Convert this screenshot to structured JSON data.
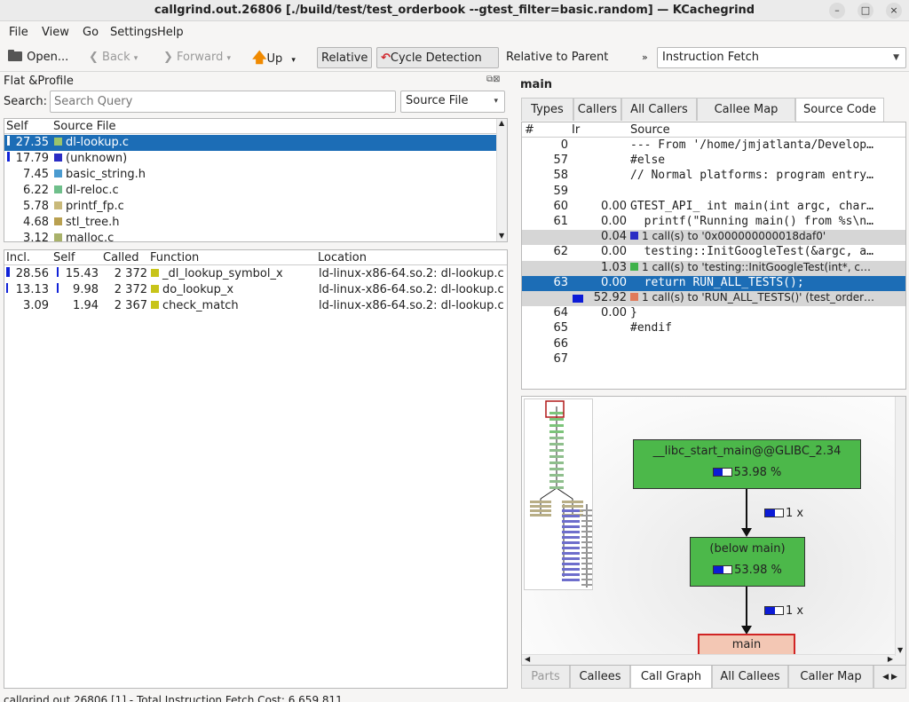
{
  "window": {
    "title": "callgrind.out.26806 [./build/test/test_orderbook --gtest_filter=basic.random] — KCachegrind",
    "btn_min": "–",
    "btn_max": "□",
    "btn_close": "×"
  },
  "menu": [
    "File",
    "View",
    "Go",
    "Settings",
    "Help"
  ],
  "toolbar": {
    "open": "Open...",
    "back": "Back",
    "forward": "Forward",
    "up": "Up",
    "relative": "Relative",
    "cycle": "Cycle Detection",
    "relative_parent": "Relative to Parent",
    "more": "»",
    "event_type": "Instruction Fetch"
  },
  "flat_profile": {
    "title": "Flat &Profile",
    "search_label": "Search:",
    "search_placeholder": "Search Query",
    "group_by": "Source File",
    "headers": [
      "Self",
      "Source File"
    ],
    "rows": [
      {
        "self": "27.35",
        "name": "dl-lookup.c",
        "color": "#9bc46b",
        "selected": true,
        "bar": true
      },
      {
        "self": "17.79",
        "name": "(unknown)",
        "color": "#2a2cc4",
        "selected": false,
        "bar": true
      },
      {
        "self": "7.45",
        "name": "basic_string.h",
        "color": "#4b9bd0",
        "selected": false,
        "bar": false
      },
      {
        "self": "6.22",
        "name": "dl-reloc.c",
        "color": "#6fbf8b",
        "selected": false,
        "bar": false
      },
      {
        "self": "5.78",
        "name": "printf_fp.c",
        "color": "#c9b97a",
        "selected": false,
        "bar": false
      },
      {
        "self": "4.68",
        "name": "stl_tree.h",
        "color": "#b9a050",
        "selected": false,
        "bar": false
      },
      {
        "self": "3.12",
        "name": "malloc.c",
        "color": "#a9b26a",
        "selected": false,
        "bar": false
      }
    ]
  },
  "functions": {
    "headers": [
      "Incl.",
      "Self",
      "Called",
      "Function",
      "Location"
    ],
    "rows": [
      {
        "incl": "28.56",
        "self": "15.43",
        "called": "2 372",
        "name": "_dl_lookup_symbol_x",
        "location": "ld-linux-x86-64.so.2: dl-lookup.c",
        "color": "#c8c41a"
      },
      {
        "incl": "13.13",
        "self": "9.98",
        "called": "2 372",
        "name": "do_lookup_x",
        "location": "ld-linux-x86-64.so.2: dl-lookup.c",
        "color": "#c8c41a"
      },
      {
        "incl": "3.09",
        "self": "1.94",
        "called": "2 367",
        "name": "check_match",
        "location": "ld-linux-x86-64.so.2: dl-lookup.c",
        "color": "#c8c41a"
      }
    ]
  },
  "right": {
    "function_name": "main",
    "tabs": [
      "Types",
      "Callers",
      "All Callers",
      "Callee Map",
      "Source Code"
    ],
    "active_tab": "Source Code",
    "source_headers": [
      "#",
      "Ir",
      "Source"
    ],
    "source_rows": [
      {
        "line": "0",
        "ir": "",
        "src": "--- From '/home/jmjatlanta/Develop…"
      },
      {
        "line": "57",
        "ir": "",
        "src": "#else"
      },
      {
        "line": "58",
        "ir": "",
        "src": "// Normal platforms: program entry…"
      },
      {
        "line": "59",
        "ir": "",
        "src": ""
      },
      {
        "line": "60",
        "ir": "0.00",
        "src": "GTEST_API_ int main(int argc, char…"
      },
      {
        "line": "61",
        "ir": "0.00",
        "src": "  printf(\"Running main() from %s\\n…"
      },
      {
        "line": "",
        "ir": "0.04",
        "call": "1 call(s) to '0x000000000018daf0'",
        "color": "#2a2cc4"
      },
      {
        "line": "62",
        "ir": "0.00",
        "src": "  testing::InitGoogleTest(&argc, a…"
      },
      {
        "line": "",
        "ir": "1.03",
        "call": "1 call(s) to 'testing::InitGoogleTest(int*, c…",
        "color": "#3fb24a"
      },
      {
        "line": "63",
        "ir": "0.00",
        "src": "  return RUN_ALL_TESTS();",
        "selected": true
      },
      {
        "line": "",
        "ir": "52.92",
        "call": "1 call(s) to 'RUN_ALL_TESTS()' (test_order…",
        "color": "#e07a5a",
        "bar": true
      },
      {
        "line": "64",
        "ir": "0.00",
        "src": "}"
      },
      {
        "line": "65",
        "ir": "",
        "src": "#endif"
      },
      {
        "line": "66",
        "ir": "",
        "src": ""
      },
      {
        "line": "67",
        "ir": "",
        "src": ""
      }
    ],
    "graph": {
      "nodes": [
        {
          "label": "__libc_start_main@@GLIBC_2.34",
          "pct": "53.98 %",
          "fill": 0.54
        },
        {
          "label": "(below main)",
          "pct": "53.98 %",
          "fill": 0.54
        },
        {
          "label": "main",
          "pct": "",
          "fill": 0
        }
      ],
      "edges": [
        {
          "calls": "1 x",
          "fill": 0.54
        },
        {
          "calls": "1 x",
          "fill": 0.54
        }
      ]
    },
    "bottom_tabs": [
      "Parts",
      "Callees",
      "Call Graph",
      "All Callees",
      "Caller Map"
    ],
    "active_bottom_tab": "Call Graph"
  },
  "status": {
    "text": "callgrind.out.26806 [1] - Total Instruction Fetch Cost: 6 659 811"
  },
  "colors": {
    "selection": "#1c6db6",
    "node_green": "#4cb84a",
    "node_main": "#f3c7b4"
  }
}
